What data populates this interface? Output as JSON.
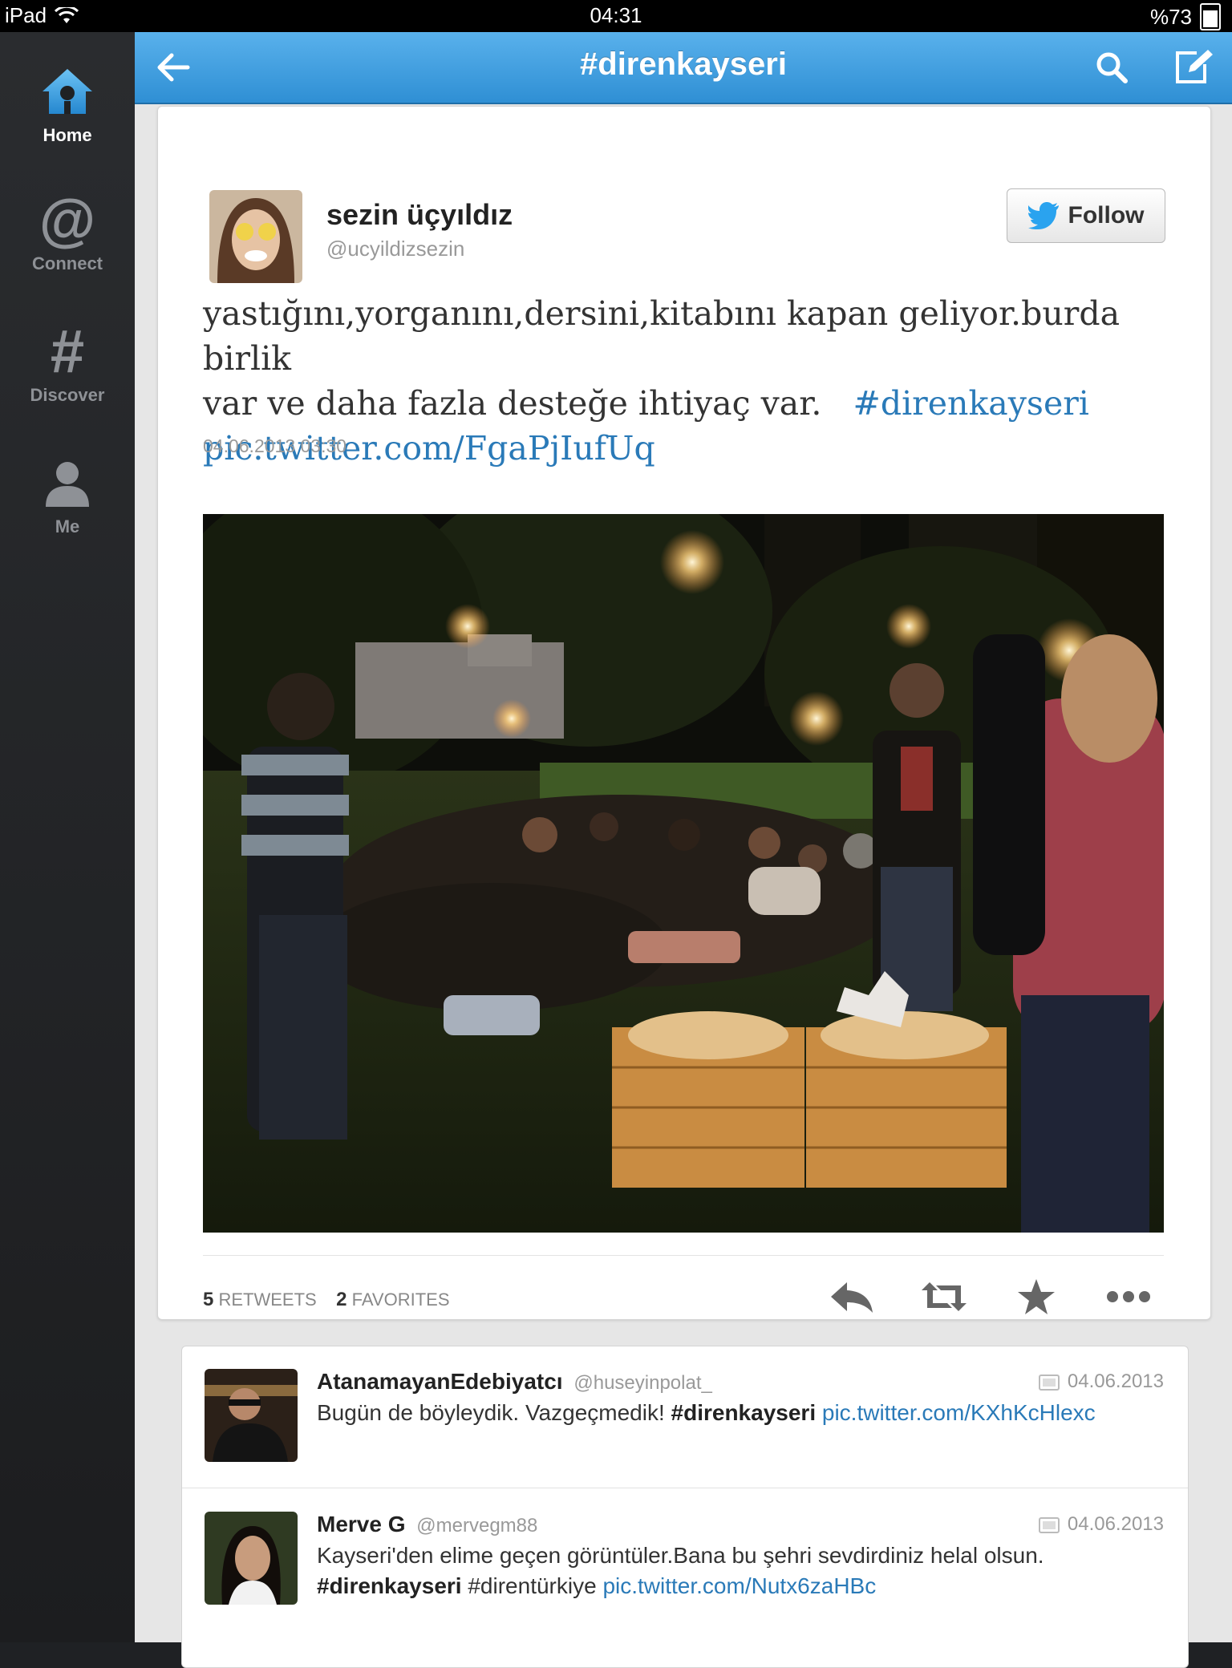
{
  "status_bar": {
    "device": "iPad",
    "time": "04:31",
    "battery": "%73"
  },
  "sidebar": {
    "items": [
      {
        "label": "Home"
      },
      {
        "label": "Connect"
      },
      {
        "label": "Discover"
      },
      {
        "label": "Me"
      }
    ]
  },
  "header": {
    "title": "#direnkayseri"
  },
  "tweet": {
    "author_name": "sezin üçyıldız",
    "author_handle": "@ucyildizsezin",
    "follow_label": "Follow",
    "text_line1": "yastığını,yorganını,dersini,kitabını kapan geliyor.burda birlik",
    "text_line2": "var ve daha fazla desteğe ihtiyaç var.",
    "hashtag": "#direnkayseri",
    "pic_link": "pic.twitter.com/FgaPjIufUq",
    "timestamp": "04.06.2013 03:30",
    "retweets_count": "5",
    "retweets_label": "RETWEETS",
    "favorites_count": "2",
    "favorites_label": "FAVORITES"
  },
  "timeline": [
    {
      "name": "AtanamayanEdebiyatcı",
      "handle": "@huseyinpolat_",
      "date": "04.06.2013",
      "text": "Bugün de böyleydik. Vazgeçmedik!",
      "hashtag": "#direnkayseri",
      "link": "pic.twitter.com/KXhKcHlexc"
    },
    {
      "name": "Merve G",
      "handle": "@mervegm88",
      "date": "04.06.2013",
      "text": "Kayseri'den elime geçen görüntüler.Bana bu şehri sevdirdiniz helal olsun.",
      "hashtag": "#direnkayseri",
      "hashtag2": "#direntürkiye",
      "link": "pic.twitter.com/Nutx6zaHBc"
    }
  ],
  "colors": {
    "accent": "#2f8fd4",
    "link": "#2a7ab8",
    "sidebar": "#1f2124"
  }
}
